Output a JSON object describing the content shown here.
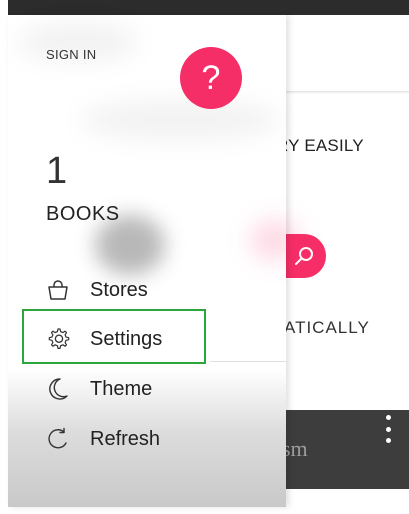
{
  "background": {
    "text_top": "RY EASILY",
    "text_mid": "ATICALLY",
    "text_bottom": "sm"
  },
  "drawer": {
    "sign_in": "SIGN IN",
    "help_icon_glyph": "?",
    "book_count": "1",
    "books_label": "BOOKS",
    "items": [
      {
        "label": "Stores",
        "icon": "bag-icon"
      },
      {
        "label": "Settings",
        "icon": "gear-icon"
      },
      {
        "label": "Theme",
        "icon": "moon-icon"
      },
      {
        "label": "Refresh",
        "icon": "refresh-icon"
      }
    ]
  },
  "colors": {
    "accent": "#f62e67",
    "highlight": "#2ba73c",
    "status_bar": "#2c2c2c",
    "bottom_bar": "#3d3d3d"
  }
}
